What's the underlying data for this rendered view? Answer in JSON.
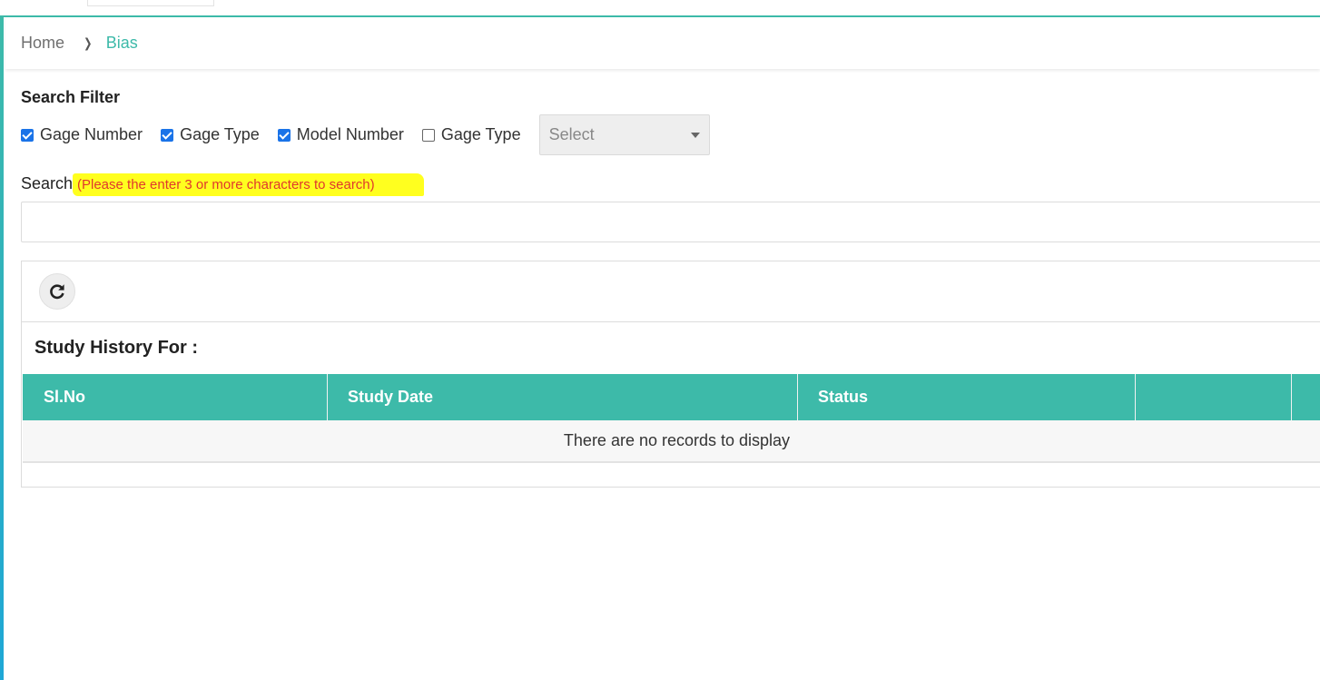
{
  "breadcrumb": {
    "home": "Home",
    "current": "Bias"
  },
  "filter": {
    "title": "Search Filter",
    "options": [
      {
        "label": "Gage Number",
        "checked": true
      },
      {
        "label": "Gage Type",
        "checked": true
      },
      {
        "label": "Model Number",
        "checked": true
      },
      {
        "label": "Gage Type",
        "checked": false
      }
    ],
    "select_value": "Select"
  },
  "search": {
    "label": "Search",
    "hint": "(Please the enter 3 or more characters to search)",
    "value": ""
  },
  "panel": {
    "refresh_icon": "refresh-icon",
    "title": "Study History For :",
    "columns": [
      "Sl.No",
      "Study Date",
      "Status",
      "",
      ""
    ],
    "empty_text": "There are no records to display"
  },
  "colors": {
    "accent": "#3dbaa9",
    "checkbox": "#1a73e8",
    "highlight": "#ffff1f",
    "hint_text": "#e0372d"
  }
}
